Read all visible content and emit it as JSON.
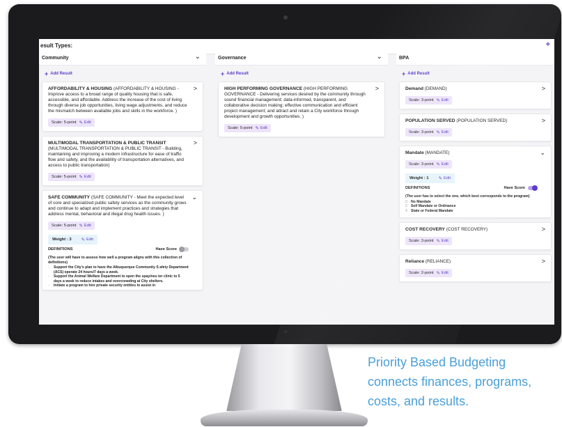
{
  "app": {
    "section_title": "esult Types:",
    "top_plus": "+"
  },
  "caption": {
    "line1": "Priority Based Budgeting",
    "line2": "connects finances, programs,",
    "line3": "costs, and results."
  },
  "colors": {
    "accent": "#5b3dc7",
    "scale_chip_bg": "#ede4f9",
    "weight_chip_bg": "#e6f3fb",
    "caption": "#4a9fd9"
  },
  "columns": [
    {
      "title": "Community",
      "chevron_icon": "chevron-down-icon",
      "add_label": "Add Result",
      "cards": [
        {
          "name": "AFFORDABILITY & HOUSING",
          "desc": "(AFFORDABILITY & HOUSING - Improve access to a broad range of quality housing that is safe, accessible, and affordable. Address the increase of the cost of living through diverse job opportunities, living wage adjustments, and reduce the mismatch between available jobs and skills in the workforce. )",
          "scale": "Scale: 5-point",
          "edit": "Edit"
        },
        {
          "name": "MULTIMODAL TRANSPORTATION & PUBLIC TRANSIT",
          "desc": "(MULTIMODAL TRANSPORTATION & PUBLIC TRANSIT - Building, maintaining and improving a modern infrastructure for ease of traffic flow and safety, and the availability of transportation alternatives, and access to public transportation)",
          "scale": "Scale: 5-point",
          "edit": "Edit"
        },
        {
          "name": "SAFE COMMUNITY",
          "desc": "(SAFE COMMUNITY - Meet the expected level of core and specialized public safety services as the community grows and continue to adapt and implement practices and strategies that address mental, behavioral and illegal drug health issues. )",
          "scale": "Scale: 5-point",
          "edit": "Edit",
          "weight": "Weight : 3",
          "definitions_label": "DEFINITIONS",
          "have_score_label": "Have Score",
          "have_score_on": false,
          "def_note": "(The user will have to assess how well a program aligns with this collection of definitions)",
          "definitions": [
            "Support the City's plan to have the Albuquerque Community S afety Department (ACS) operate 24 hours/7 days a week.",
            "Support the Animal Welfare Department to open the spay/neu ter clinic to 5 days a week to reduce intakes and overcrowding at City shelters.",
            "Initiate a program to hire private security entities to assist in"
          ]
        }
      ]
    },
    {
      "title": "Governance",
      "chevron_icon": "chevron-down-icon",
      "add_label": "Add Result",
      "cards": [
        {
          "name": "HIGH PERFORMING GOVERNANCE",
          "desc": "(HIGH PERFORMING GOVERNANCE - Delivering services desired by the community through sound financial management; data-informed, transparent, and collaborative decision making; effective communication and efficient project management; and attract and retain a City workforce through development and growth opportunities. )",
          "scale": "Scale: 5-point",
          "edit": "Edit"
        }
      ]
    },
    {
      "title": "BPA",
      "add_label": "Add Result",
      "cards": [
        {
          "name": "Demand",
          "desc": "(DEMAND)",
          "scale": "Scale: 3-point",
          "edit": "Edit"
        },
        {
          "name": "POPULATION SERVED",
          "desc": "(POPULATION SERVED)",
          "scale": "Scale: 3-point",
          "edit": "Edit"
        },
        {
          "name": "Mandate",
          "desc": "(MANDATE)",
          "scale": "Scale: 3-point",
          "edit": "Edit",
          "weight": "Weight : 1",
          "definitions_label": "DEFINITIONS",
          "have_score_label": "Have Score",
          "have_score_on": true,
          "def_note": "(The user has to select the one, which best corresponds to the program)",
          "options": [
            {
              "num": "0",
              "text": "No Mandate"
            },
            {
              "num": "2",
              "text": "Self Mandate or Ordinance"
            },
            {
              "num": "4",
              "text": "State or Federal Mandate"
            }
          ]
        },
        {
          "name": "COST RECOVERY",
          "desc": "(COST RECOVERY)",
          "scale": "Scale: 3-point",
          "edit": "Edit"
        },
        {
          "name": "Reliance",
          "desc": "(RELIANCE)",
          "scale": "Scale: 2-point",
          "edit": "Edit"
        }
      ]
    }
  ]
}
